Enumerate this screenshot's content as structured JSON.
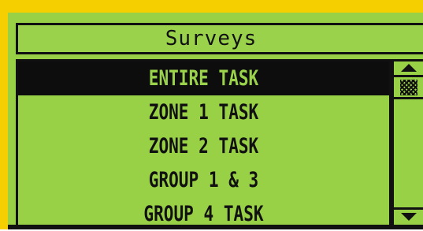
{
  "screen": {
    "title": "Surveys"
  },
  "list": {
    "items": [
      {
        "label": "ENTIRE TASK",
        "selected": true
      },
      {
        "label": "ZONE 1 TASK",
        "selected": false
      },
      {
        "label": "ZONE 2 TASK",
        "selected": false
      },
      {
        "label": "GROUP 1 & 3",
        "selected": false
      },
      {
        "label": "GROUP 4 TASK",
        "selected": false
      }
    ]
  },
  "scrollbar": {
    "up_icon": "arrow-up-icon",
    "down_icon": "arrow-down-icon",
    "thumb_position_fraction": 0.0
  },
  "colors": {
    "bezel": "#f6cf00",
    "lcd_background": "#99d146",
    "lcd_ink": "#111111"
  }
}
